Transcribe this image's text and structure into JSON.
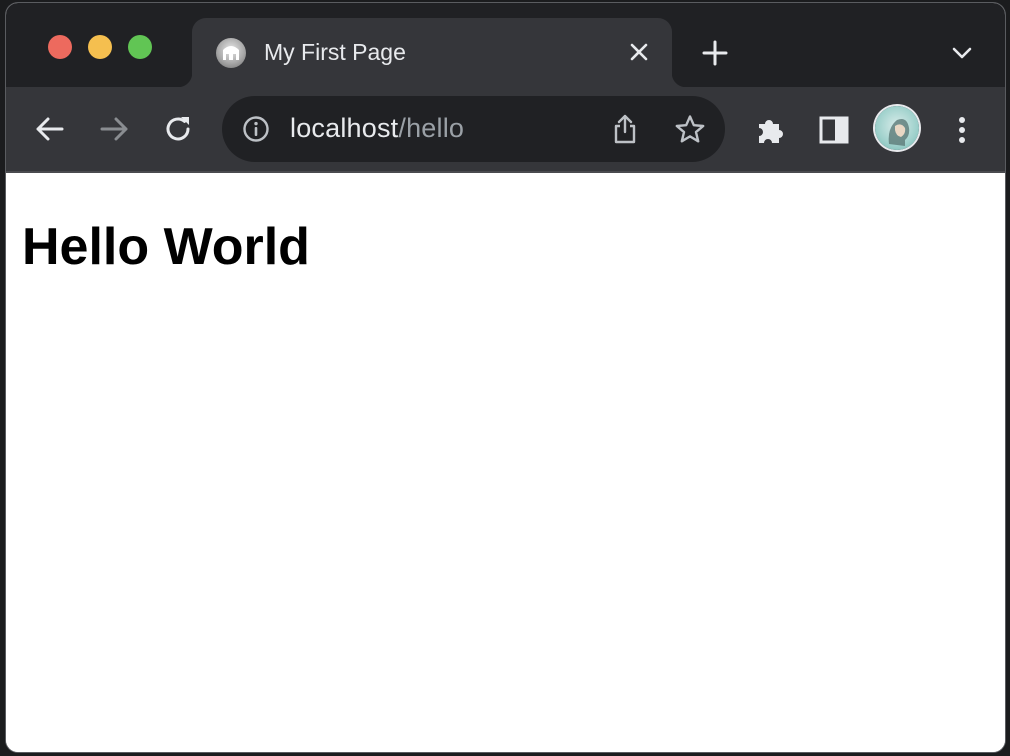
{
  "window_controls": {
    "close_color": "#ed6a5e",
    "minimize_color": "#f5bf4f",
    "maximize_color": "#61c554"
  },
  "tab": {
    "title": "My First Page",
    "favicon": "gray-circle-favicon",
    "close_icon": "close-icon"
  },
  "tabstrip": {
    "new_tab_icon": "plus-icon",
    "tab_search_icon": "chevron-down-icon"
  },
  "toolbar": {
    "back_icon": "arrow-left-icon",
    "forward_icon": "arrow-right-icon",
    "reload_icon": "reload-icon",
    "address": {
      "host": "localhost",
      "path": "/hello",
      "info_icon": "info-icon",
      "share_icon": "share-icon",
      "bookmark_icon": "star-icon"
    },
    "extensions_icon": "puzzle-icon",
    "side_panel_icon": "side-panel-icon",
    "profile_icon": "avatar",
    "menu_icon": "kebab-menu-icon"
  },
  "page": {
    "heading": "Hello World"
  },
  "colors": {
    "tabstrip_bg": "#202124",
    "toolbar_bg": "#35363a",
    "omnibox_bg": "#202124",
    "text_light": "#e8eaed",
    "text_dim": "#9aa0a6"
  }
}
